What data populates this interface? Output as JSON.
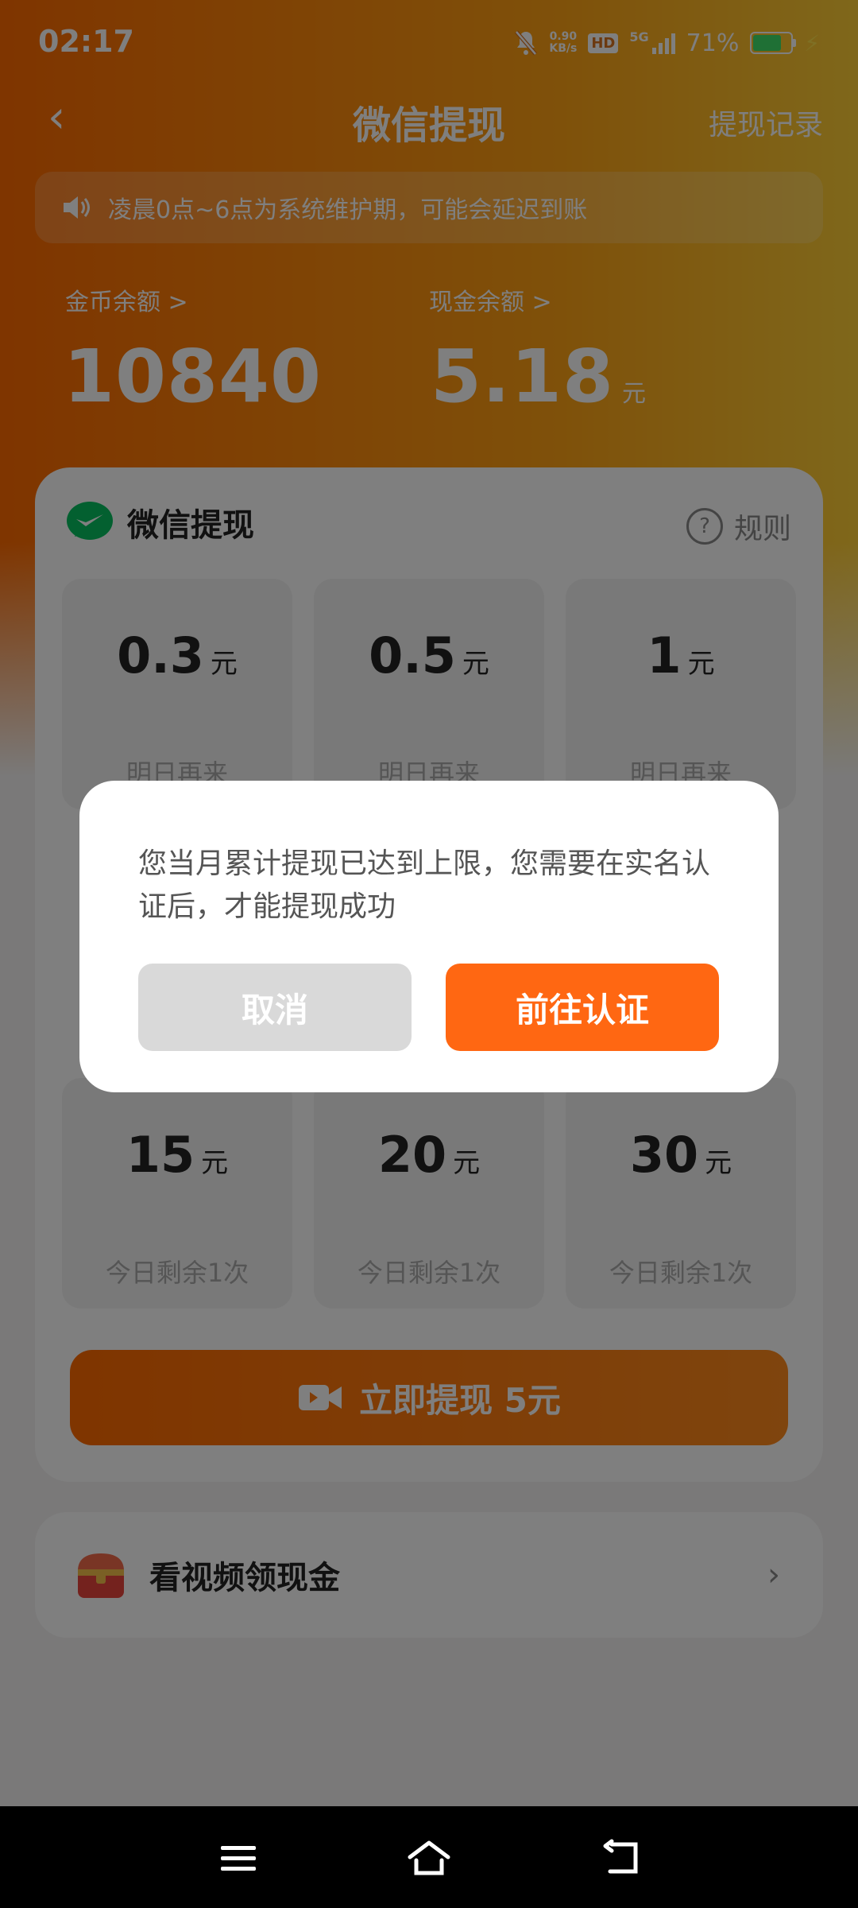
{
  "status": {
    "time": "02:17",
    "net_speed_value": "0.90",
    "net_speed_unit": "KB/s",
    "hd": "HD",
    "network": "5G",
    "battery": "71%"
  },
  "nav": {
    "back_glyph": "‹",
    "title": "微信提现",
    "record": "提现记录"
  },
  "notice": {
    "text": "凌晨0点~6点为系统维护期，可能会延迟到账"
  },
  "balances": {
    "coin_label": "金币余额 >",
    "coin_value": "10840",
    "cash_label": "现金余额 >",
    "cash_value": "5.18",
    "cash_unit": "元"
  },
  "card": {
    "title": "微信提现",
    "rules": "规则",
    "options": [
      {
        "amount": "0.3",
        "unit": "元",
        "note": "明日再来"
      },
      {
        "amount": "0.5",
        "unit": "元",
        "note": "明日再来"
      },
      {
        "amount": "1",
        "unit": "元",
        "note": "明日再来"
      },
      {
        "amount": "15",
        "unit": "元",
        "note": "今日剩余1次"
      },
      {
        "amount": "20",
        "unit": "元",
        "note": "今日剩余1次"
      },
      {
        "amount": "30",
        "unit": "元",
        "note": "今日剩余1次"
      }
    ],
    "withdraw_button": "立即提现 5元"
  },
  "video_task": {
    "label": "看视频领现金",
    "chevron": "›"
  },
  "dialog": {
    "message": "您当月累计提现已达到上限，您需要在实名认证后，才能提现成功",
    "cancel": "取消",
    "confirm": "前往认证"
  },
  "colors": {
    "accent": "#ff6712",
    "wechat_green": "#07c160",
    "overlay": "rgba(0,0,0,0.5)"
  },
  "icons": [
    "mute-bell-icon",
    "hd-icon",
    "signal-icon",
    "battery-icon",
    "charging-icon",
    "back-icon",
    "speaker-icon",
    "wechat-icon",
    "help-icon",
    "video-camera-icon",
    "treasure-chest-icon",
    "chevron-right-icon",
    "menu-icon",
    "home-icon",
    "return-icon"
  ]
}
